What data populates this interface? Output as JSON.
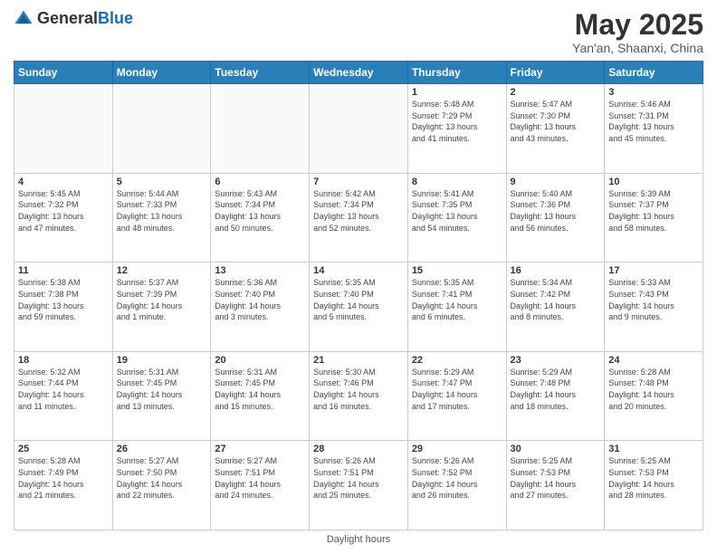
{
  "logo": {
    "text_general": "General",
    "text_blue": "Blue"
  },
  "title": "May 2025",
  "subtitle": "Yan'an, Shaanxi, China",
  "days_of_week": [
    "Sunday",
    "Monday",
    "Tuesday",
    "Wednesday",
    "Thursday",
    "Friday",
    "Saturday"
  ],
  "weeks": [
    [
      {
        "day": "",
        "info": ""
      },
      {
        "day": "",
        "info": ""
      },
      {
        "day": "",
        "info": ""
      },
      {
        "day": "",
        "info": ""
      },
      {
        "day": "1",
        "info": "Sunrise: 5:48 AM\nSunset: 7:29 PM\nDaylight: 13 hours\nand 41 minutes."
      },
      {
        "day": "2",
        "info": "Sunrise: 5:47 AM\nSunset: 7:30 PM\nDaylight: 13 hours\nand 43 minutes."
      },
      {
        "day": "3",
        "info": "Sunrise: 5:46 AM\nSunset: 7:31 PM\nDaylight: 13 hours\nand 45 minutes."
      }
    ],
    [
      {
        "day": "4",
        "info": "Sunrise: 5:45 AM\nSunset: 7:32 PM\nDaylight: 13 hours\nand 47 minutes."
      },
      {
        "day": "5",
        "info": "Sunrise: 5:44 AM\nSunset: 7:33 PM\nDaylight: 13 hours\nand 48 minutes."
      },
      {
        "day": "6",
        "info": "Sunrise: 5:43 AM\nSunset: 7:34 PM\nDaylight: 13 hours\nand 50 minutes."
      },
      {
        "day": "7",
        "info": "Sunrise: 5:42 AM\nSunset: 7:34 PM\nDaylight: 13 hours\nand 52 minutes."
      },
      {
        "day": "8",
        "info": "Sunrise: 5:41 AM\nSunset: 7:35 PM\nDaylight: 13 hours\nand 54 minutes."
      },
      {
        "day": "9",
        "info": "Sunrise: 5:40 AM\nSunset: 7:36 PM\nDaylight: 13 hours\nand 56 minutes."
      },
      {
        "day": "10",
        "info": "Sunrise: 5:39 AM\nSunset: 7:37 PM\nDaylight: 13 hours\nand 58 minutes."
      }
    ],
    [
      {
        "day": "11",
        "info": "Sunrise: 5:38 AM\nSunset: 7:38 PM\nDaylight: 13 hours\nand 59 minutes."
      },
      {
        "day": "12",
        "info": "Sunrise: 5:37 AM\nSunset: 7:39 PM\nDaylight: 14 hours\nand 1 minute."
      },
      {
        "day": "13",
        "info": "Sunrise: 5:36 AM\nSunset: 7:40 PM\nDaylight: 14 hours\nand 3 minutes."
      },
      {
        "day": "14",
        "info": "Sunrise: 5:35 AM\nSunset: 7:40 PM\nDaylight: 14 hours\nand 5 minutes."
      },
      {
        "day": "15",
        "info": "Sunrise: 5:35 AM\nSunset: 7:41 PM\nDaylight: 14 hours\nand 6 minutes."
      },
      {
        "day": "16",
        "info": "Sunrise: 5:34 AM\nSunset: 7:42 PM\nDaylight: 14 hours\nand 8 minutes."
      },
      {
        "day": "17",
        "info": "Sunrise: 5:33 AM\nSunset: 7:43 PM\nDaylight: 14 hours\nand 9 minutes."
      }
    ],
    [
      {
        "day": "18",
        "info": "Sunrise: 5:32 AM\nSunset: 7:44 PM\nDaylight: 14 hours\nand 11 minutes."
      },
      {
        "day": "19",
        "info": "Sunrise: 5:31 AM\nSunset: 7:45 PM\nDaylight: 14 hours\nand 13 minutes."
      },
      {
        "day": "20",
        "info": "Sunrise: 5:31 AM\nSunset: 7:45 PM\nDaylight: 14 hours\nand 15 minutes."
      },
      {
        "day": "21",
        "info": "Sunrise: 5:30 AM\nSunset: 7:46 PM\nDaylight: 14 hours\nand 16 minutes."
      },
      {
        "day": "22",
        "info": "Sunrise: 5:29 AM\nSunset: 7:47 PM\nDaylight: 14 hours\nand 17 minutes."
      },
      {
        "day": "23",
        "info": "Sunrise: 5:29 AM\nSunset: 7:48 PM\nDaylight: 14 hours\nand 18 minutes."
      },
      {
        "day": "24",
        "info": "Sunrise: 5:28 AM\nSunset: 7:48 PM\nDaylight: 14 hours\nand 20 minutes."
      }
    ],
    [
      {
        "day": "25",
        "info": "Sunrise: 5:28 AM\nSunset: 7:49 PM\nDaylight: 14 hours\nand 21 minutes."
      },
      {
        "day": "26",
        "info": "Sunrise: 5:27 AM\nSunset: 7:50 PM\nDaylight: 14 hours\nand 22 minutes."
      },
      {
        "day": "27",
        "info": "Sunrise: 5:27 AM\nSunset: 7:51 PM\nDaylight: 14 hours\nand 24 minutes."
      },
      {
        "day": "28",
        "info": "Sunrise: 5:26 AM\nSunset: 7:51 PM\nDaylight: 14 hours\nand 25 minutes."
      },
      {
        "day": "29",
        "info": "Sunrise: 5:26 AM\nSunset: 7:52 PM\nDaylight: 14 hours\nand 26 minutes."
      },
      {
        "day": "30",
        "info": "Sunrise: 5:25 AM\nSunset: 7:53 PM\nDaylight: 14 hours\nand 27 minutes."
      },
      {
        "day": "31",
        "info": "Sunrise: 5:25 AM\nSunset: 7:53 PM\nDaylight: 14 hours\nand 28 minutes."
      }
    ]
  ],
  "footer": {
    "label": "Daylight hours"
  }
}
